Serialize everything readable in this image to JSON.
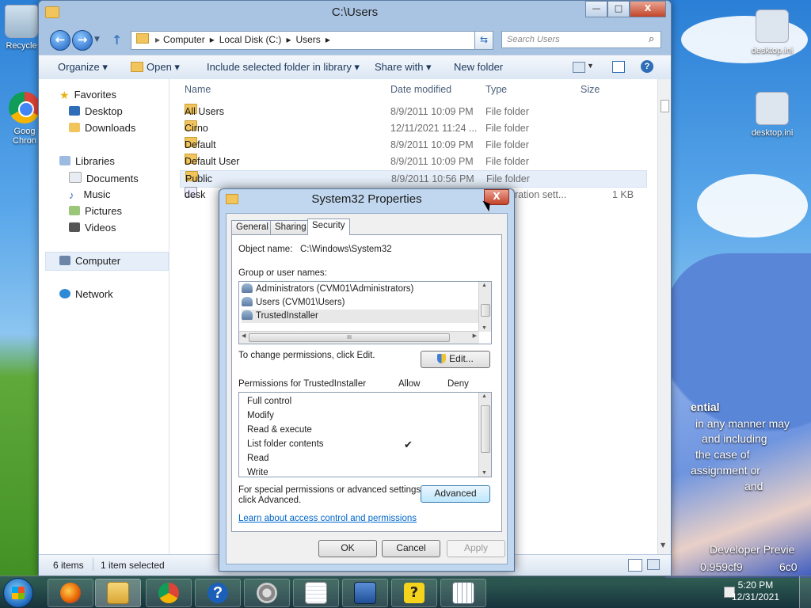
{
  "desktop": {
    "icons": [
      {
        "label": "Recycle"
      },
      {
        "label": "Goog Chron"
      },
      {
        "label": "desktop.ini"
      },
      {
        "label": "desktop.ini"
      }
    ],
    "bg_text": [
      {
        "text": "ential"
      },
      {
        "text": "in any manner may"
      },
      {
        "text": "and including"
      },
      {
        "text": "the case of"
      },
      {
        "text": "assignment or"
      },
      {
        "text": "and"
      },
      {
        "text": "Developer Previe"
      },
      {
        "text": "0.959cf9"
      },
      {
        "text": "6c0"
      }
    ]
  },
  "explorer": {
    "title": "C:\\Users",
    "window_buttons": {
      "minimize": "—",
      "maximize": "□",
      "close": "X"
    },
    "nav": {
      "back": "←",
      "forward": "→",
      "up": "↑"
    },
    "address": {
      "parts": [
        "Computer",
        "▸",
        "Local Disk (C:)",
        "▸",
        "Users",
        "▸"
      ]
    },
    "search": {
      "placeholder": "Search Users"
    },
    "toolbar": {
      "organize": "Organize ▾",
      "open": "Open ▾",
      "include": "Include selected folder in library ▾",
      "share": "Share with ▾",
      "new_folder": "New folder"
    },
    "navpane": {
      "favorites": "Favorites",
      "desktop": "Desktop",
      "downloads": "Downloads",
      "libraries": "Libraries",
      "documents": "Documents",
      "music": "Music",
      "pictures": "Pictures",
      "videos": "Videos",
      "computer": "Computer",
      "network": "Network"
    },
    "columns": {
      "name": "Name",
      "date": "Date modified",
      "type": "Type",
      "size": "Size"
    },
    "files": [
      {
        "name": "All Users",
        "date": "8/9/2011 10:09 PM",
        "type": "File folder",
        "size": ""
      },
      {
        "name": "Cirno",
        "date": "12/11/2021 11:24 ...",
        "type": "File folder",
        "size": ""
      },
      {
        "name": "Default",
        "date": "8/9/2011 10:09 PM",
        "type": "File folder",
        "size": ""
      },
      {
        "name": "Default User",
        "date": "8/9/2011 10:09 PM",
        "type": "File folder",
        "size": ""
      },
      {
        "name": "Public",
        "date": "8/9/2011 10:56 PM",
        "type": "File folder",
        "size": ""
      },
      {
        "name": "desk",
        "date": "",
        "type": "uration sett...",
        "size": "1 KB"
      }
    ],
    "status": {
      "items": "6 items",
      "selected": "1 item selected"
    }
  },
  "dialog": {
    "title": "System32 Properties",
    "close": "X",
    "tabs": [
      "General",
      "Sharing",
      "Security"
    ],
    "object_label": "Object name:",
    "object_value": "C:\\Windows\\System32",
    "groups_label": "Group or user names:",
    "groups": [
      "Administrators (CVM01\\Administrators)",
      "Users (CVM01\\Users)",
      "TrustedInstaller"
    ],
    "hscroll_grip": "III",
    "change_text": "To change permissions, click Edit.",
    "edit_button": "Edit...",
    "perm_header": "Permissions for TrustedInstaller",
    "allow": "Allow",
    "deny": "Deny",
    "permissions": [
      {
        "name": "Full control",
        "allow": "",
        "deny": ""
      },
      {
        "name": "Modify",
        "allow": "",
        "deny": ""
      },
      {
        "name": "Read & execute",
        "allow": "",
        "deny": ""
      },
      {
        "name": "List folder contents",
        "allow": "✔",
        "deny": ""
      },
      {
        "name": "Read",
        "allow": "",
        "deny": ""
      },
      {
        "name": "Write",
        "allow": "",
        "deny": ""
      }
    ],
    "special_text_1": "For special permissions or advanced settings,",
    "special_text_2": "click Advanced.",
    "advanced_button": "Advanced",
    "learn_link": "Learn about access control and permissions",
    "ok": "OK",
    "cancel": "Cancel",
    "apply": "Apply"
  },
  "taskbar": {
    "clock_time": "5:20 PM",
    "clock_date": "12/31/2021",
    "help_glyph": "?"
  },
  "colors": {
    "accent": "#1d5fbf",
    "close_red": "#c3432a",
    "link": "#0066cc"
  }
}
